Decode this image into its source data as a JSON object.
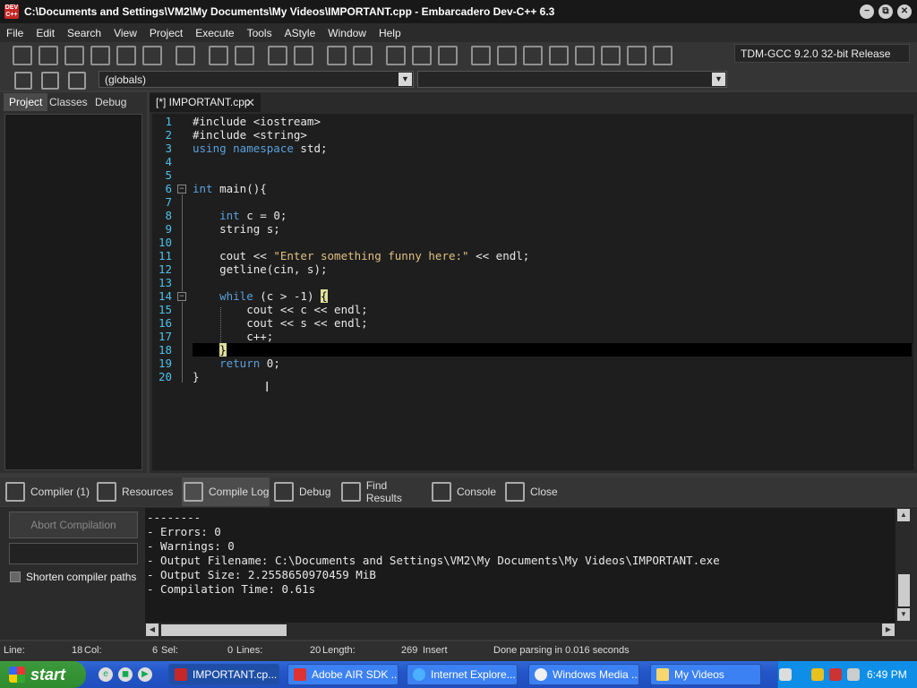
{
  "window": {
    "title": "C:\\Documents and Settings\\VM2\\My Documents\\My Videos\\IMPORTANT.cpp - Embarcadero Dev-C++ 6.3",
    "app_icon_text": "DEV C++",
    "minimize": "−",
    "maximize": "⧉",
    "close": "✕"
  },
  "menu": [
    "File",
    "Edit",
    "Search",
    "View",
    "Project",
    "Execute",
    "Tools",
    "AStyle",
    "Window",
    "Help"
  ],
  "toolbar": {
    "compiler": "TDM-GCC 9.2.0 32-bit Release"
  },
  "toolbar2": {
    "scope": "(globals)",
    "function": ""
  },
  "left_panel": {
    "tabs": [
      "Project",
      "Classes",
      "Debug"
    ]
  },
  "editor": {
    "file_tab": "[*] IMPORTANT.cpp",
    "line_numbers": [
      "1",
      "2",
      "3",
      "4",
      "5",
      "6",
      "7",
      "8",
      "9",
      "10",
      "11",
      "12",
      "13",
      "14",
      "15",
      "16",
      "17",
      "18",
      "19",
      "20"
    ]
  },
  "bottom_tabs": [
    "Compiler (1)",
    "Resources",
    "Compile Log",
    "Debug",
    "Find Results",
    "Console",
    "Close"
  ],
  "compile_panel": {
    "abort_button": "Abort Compilation",
    "shorten_paths_label": "Shorten compiler paths",
    "log_lines": [
      "--------",
      "- Errors: 0",
      "- Warnings: 0",
      "- Output Filename: C:\\Documents and Settings\\VM2\\My Documents\\My Videos\\IMPORTANT.exe",
      "- Output Size: 2.2558650970459 MiB",
      "- Compilation Time: 0.61s"
    ]
  },
  "status_bar": {
    "line_label": "Line:",
    "line_value": "18",
    "col_label": "Col:",
    "col_value": "6",
    "sel_label": "Sel:",
    "sel_value": "0",
    "lines_label": "Lines:",
    "lines_value": "20",
    "length_label": "Length:",
    "length_value": "269",
    "mode": "Insert",
    "message": "Done parsing in 0.016 seconds"
  },
  "taskbar": {
    "start": "start",
    "tasks": [
      "IMPORTANT.cp...",
      "Adobe AIR SDK ...",
      "Internet Explore...",
      "Windows Media ...",
      "My Videos"
    ],
    "clock": "6:49 PM"
  }
}
